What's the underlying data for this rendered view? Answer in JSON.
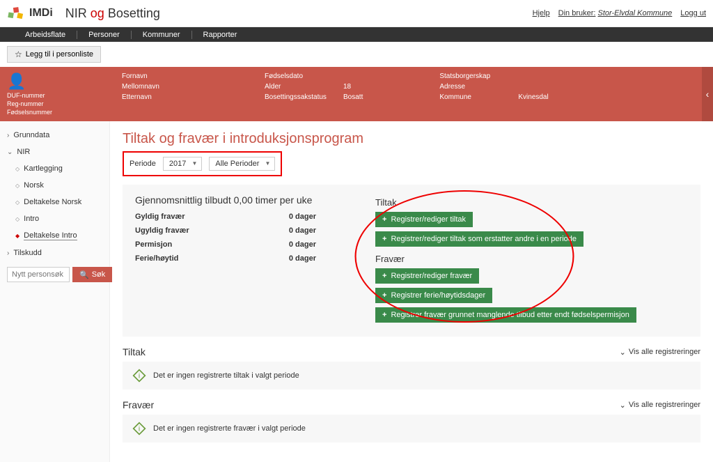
{
  "header": {
    "imdi": "IMDi",
    "nir_prefix": "NIR",
    "nir_og": "og",
    "nir_suffix": "Bosetting",
    "help": "Hjelp",
    "user_label": "Din bruker:",
    "user_name": "Stor-Elvdal Kommune",
    "logout": "Logg ut"
  },
  "nav": {
    "arbeidsflate": "Arbeidsflate",
    "personer": "Personer",
    "kommuner": "Kommuner",
    "rapporter": "Rapporter"
  },
  "toolbar": {
    "personliste": "Legg til i personliste"
  },
  "banner": {
    "duf": "DUF-nummer",
    "reg": "Reg-nummer",
    "fnr": "Fødselsnummer",
    "fornavn_l": "Fornavn",
    "mellomnavn_l": "Mellomnavn",
    "etternavn_l": "Etternavn",
    "fodselsdato_l": "Fødselsdato",
    "alder_l": "Alder",
    "alder_v": "18",
    "bosetting_l": "Bosettingssakstatus",
    "bosetting_v": "Bosatt",
    "statsborger_l": "Statsborgerskap",
    "adresse_l": "Adresse",
    "kommune_l": "Kommune",
    "kommune_v": "Kvinesdal"
  },
  "sidebar": {
    "grunndata": "Grunndata",
    "nir": "NIR",
    "kartlegging": "Kartlegging",
    "norsk": "Norsk",
    "deltakelse_norsk": "Deltakelse Norsk",
    "intro": "Intro",
    "deltakelse_intro": "Deltakelse Intro",
    "tilskudd": "Tilskudd",
    "search_placeholder": "Nytt personsøk",
    "search_btn": "Søk"
  },
  "page": {
    "title": "Tiltak og fravær i introduksjonsprogram",
    "periode_label": "Periode",
    "year": "2017",
    "alle_perioder": "Alle Perioder"
  },
  "card1": {
    "avg_heading": "Gjennomsnittlig tilbudt 0,00 timer per uke",
    "gyldig": "Gyldig fravær",
    "ugyldig": "Ugyldig fravær",
    "permisjon": "Permisjon",
    "ferie": "Ferie/høytid",
    "val": "0 dager",
    "tiltak_h": "Tiltak",
    "btn_tiltak": "Registrer/rediger tiltak",
    "btn_tiltak_erstatter": "Registrer/rediger tiltak som erstatter andre i en periode",
    "fravaer_h": "Fravær",
    "btn_fravaer": "Registrer/rediger fravær",
    "btn_ferie": "Registrer ferie/høytidsdager",
    "btn_fravaer_tilbud": "Registrer fravær grunnet manglende tilbud etter endt fødselspermisjon"
  },
  "sections": {
    "tiltak": "Tiltak",
    "fravaer": "Fravær",
    "vis_alle": "Vis alle registreringer",
    "no_tiltak": "Det er ingen registrerte tiltak i valgt periode",
    "no_fravaer": "Det er ingen registrerte fravær i valgt periode"
  }
}
